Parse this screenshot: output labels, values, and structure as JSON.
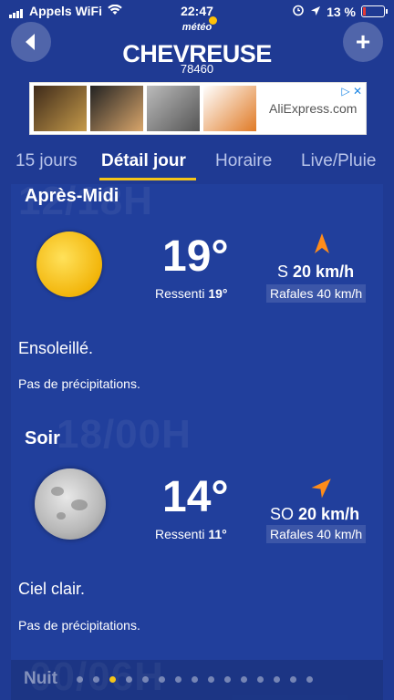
{
  "status_bar": {
    "carrier": "Appels WiFi",
    "time": "22:47",
    "battery": "13 %"
  },
  "header": {
    "logo": "météo",
    "city": "CHEVREUSE",
    "postcode": "78460"
  },
  "ad": {
    "text": "AliExpress.com"
  },
  "tabs": [
    {
      "label": "15 jours"
    },
    {
      "label": "Détail jour",
      "active": true
    },
    {
      "label": "Horaire"
    },
    {
      "label": "Live/Pluie"
    }
  ],
  "periods": [
    {
      "big_time": "12/18H",
      "title": "Après-Midi",
      "icon": "sun-icon",
      "temp": "19°",
      "felt_label": "Ressenti",
      "felt_value": "19°",
      "wind_dir": "S",
      "wind_speed": "20 km/h",
      "gusts": "Rafales 40 km/h",
      "description": "Ensoleillé.",
      "precip": "Pas de précipitations."
    },
    {
      "big_time": "18/00H",
      "title": "Soir",
      "icon": "moon-icon",
      "temp": "14°",
      "felt_label": "Ressenti",
      "felt_value": "11°",
      "wind_dir": "SO",
      "wind_speed": "20 km/h",
      "gusts": "Rafales 40 km/h",
      "description": "Ciel clair.",
      "precip": "Pas de précipitations."
    }
  ],
  "next": {
    "big_time": "00/06H",
    "title": "Nuit"
  },
  "pager": {
    "count": 15,
    "active_index": 2
  },
  "colors": {
    "background": "#1f3a93",
    "accent": "#f5c518",
    "wind_arrow": "#ff8c1a"
  }
}
